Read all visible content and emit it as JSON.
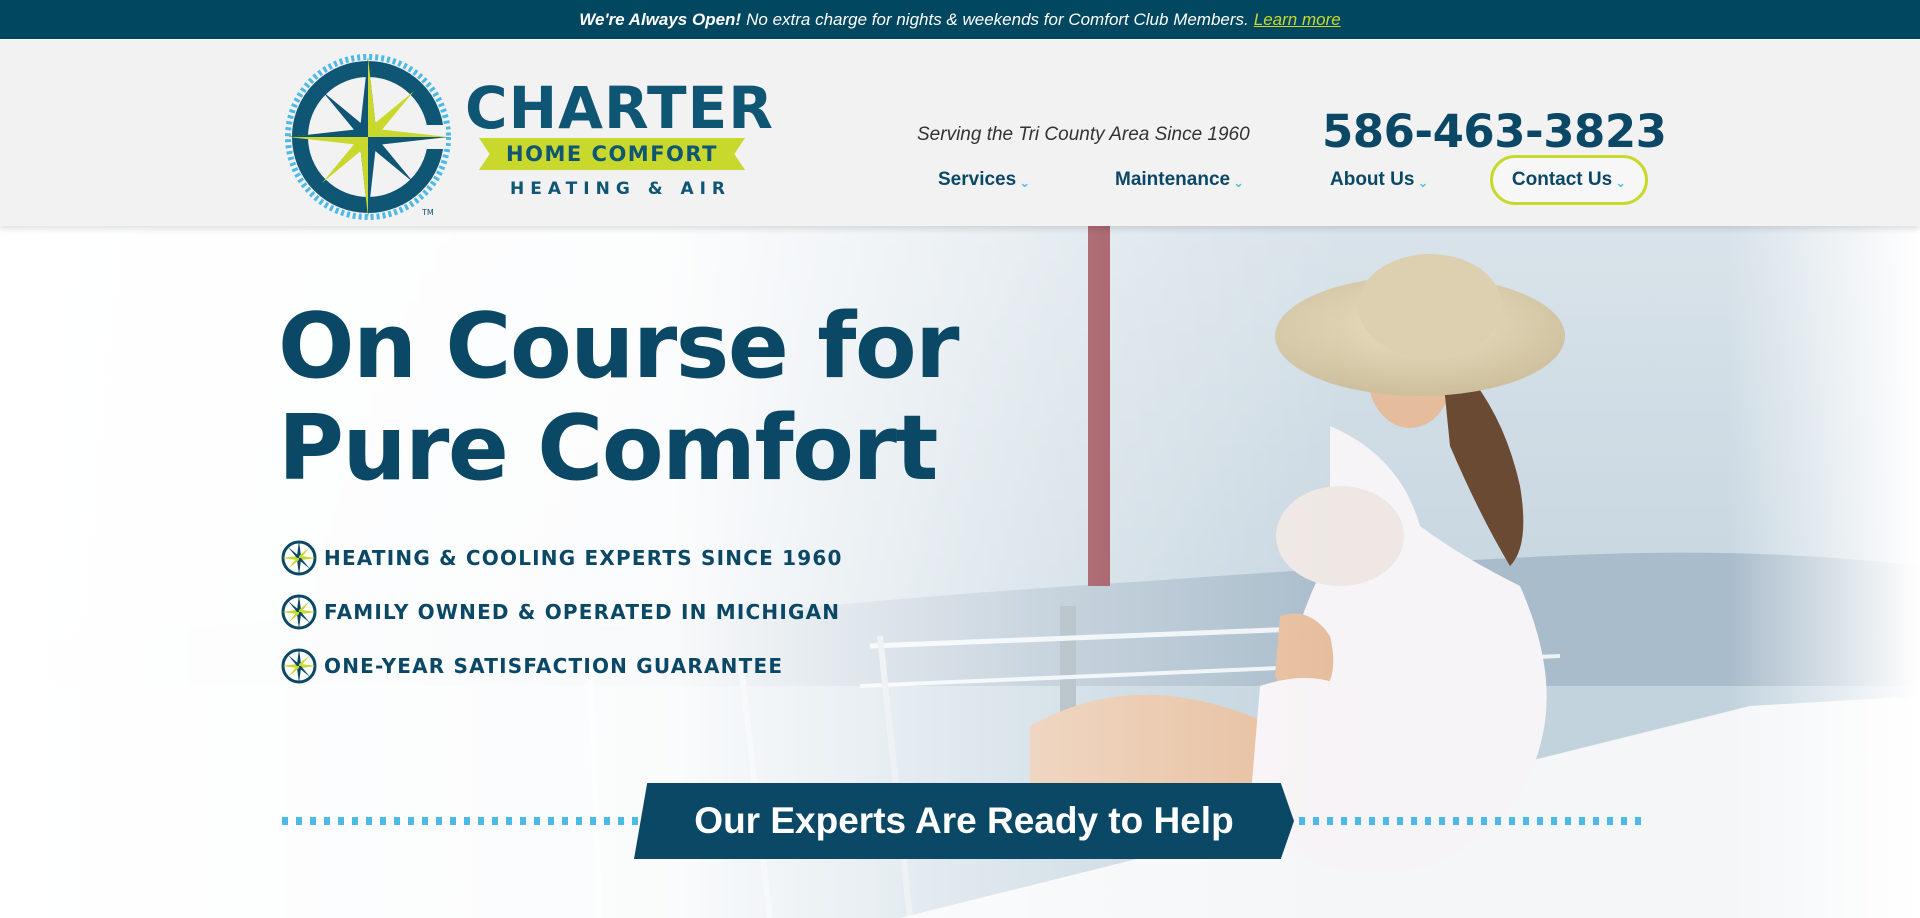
{
  "topbar": {
    "bold": "We're Always Open!",
    "message": "No extra charge for nights & weekends for Comfort Club Members.",
    "link": "Learn more"
  },
  "header": {
    "logo": {
      "name": "CHARTER",
      "banner": "HOME COMFORT",
      "sub": "HEATING & AIR",
      "tm": "TM"
    },
    "tagline": "Serving the Tri County Area Since 1960",
    "phone": "586-463-3823",
    "nav": [
      {
        "label": "Services"
      },
      {
        "label": "Maintenance"
      },
      {
        "label": "About Us"
      },
      {
        "label": "Contact Us"
      }
    ]
  },
  "hero": {
    "title_line1": "On Course for",
    "title_line2": "Pure Comfort",
    "features": [
      "HEATING & COOLING EXPERTS SINCE 1960",
      "FAMILY OWNED & OPERATED IN MICHIGAN",
      "ONE-YEAR SATISFACTION GUARANTEE"
    ],
    "banner": "Our Experts Are Ready to Help"
  },
  "colors": {
    "navy": "#0b4866",
    "topbar": "#00475f",
    "lime": "#c9d82c",
    "sky": "#4db9e6",
    "header_bg": "#f2f2f3"
  },
  "icons": {
    "feature_bullet": "compass-icon",
    "nav_chevron": "chevron-down-icon"
  }
}
